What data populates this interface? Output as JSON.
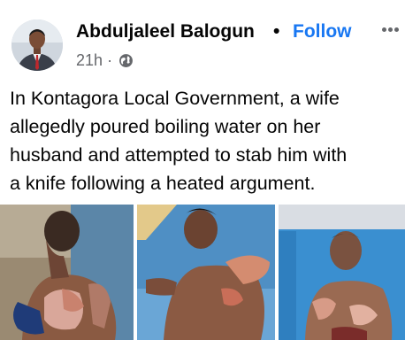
{
  "post": {
    "author": "Abduljaleel Balogun",
    "separator": "•",
    "follow_label": "Follow",
    "timestamp": "21h",
    "meta_dot": "·",
    "privacy_icon": "globe-icon",
    "text_lines": [
      "In Kontagora Local Government, a wife",
      "allegedly poured boiling water on her",
      "husband and attempted to stab him with",
      "a knife following a heated argument."
    ]
  },
  "colors": {
    "accent": "#1877f2",
    "text": "#050505",
    "secondary": "#65676b"
  },
  "photos": [
    {
      "name": "photo-1"
    },
    {
      "name": "photo-2"
    },
    {
      "name": "photo-3"
    }
  ]
}
